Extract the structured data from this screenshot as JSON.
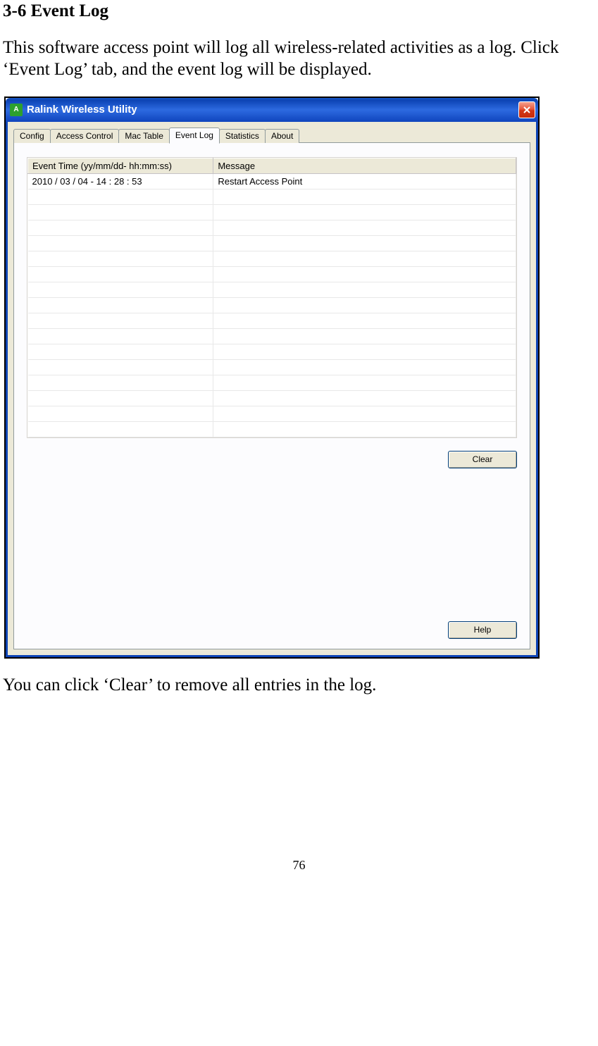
{
  "doc": {
    "heading": "3-6 Event Log",
    "para1": "This software access point will log all wireless-related activities as a log. Click ‘Event Log’ tab, and the event log will be displayed.",
    "para2": "You can click ‘Clear’ to remove all entries in the log.",
    "page_number": "76"
  },
  "window": {
    "title": "Ralink Wireless Utility",
    "close_label": "Close"
  },
  "tabs": {
    "config": "Config",
    "access_control": "Access Control",
    "mac_table": "Mac Table",
    "event_log": "Event Log",
    "statistics": "Statistics",
    "about": "About"
  },
  "table": {
    "header_time": "Event Time (yy/mm/dd- hh:mm:ss)",
    "header_message": "Message",
    "rows": [
      {
        "time": "2010 / 03 / 04 - 14 : 28 : 53",
        "message": "Restart Access Point"
      }
    ],
    "empty_row_count": 16
  },
  "buttons": {
    "clear": "Clear",
    "help": "Help"
  }
}
